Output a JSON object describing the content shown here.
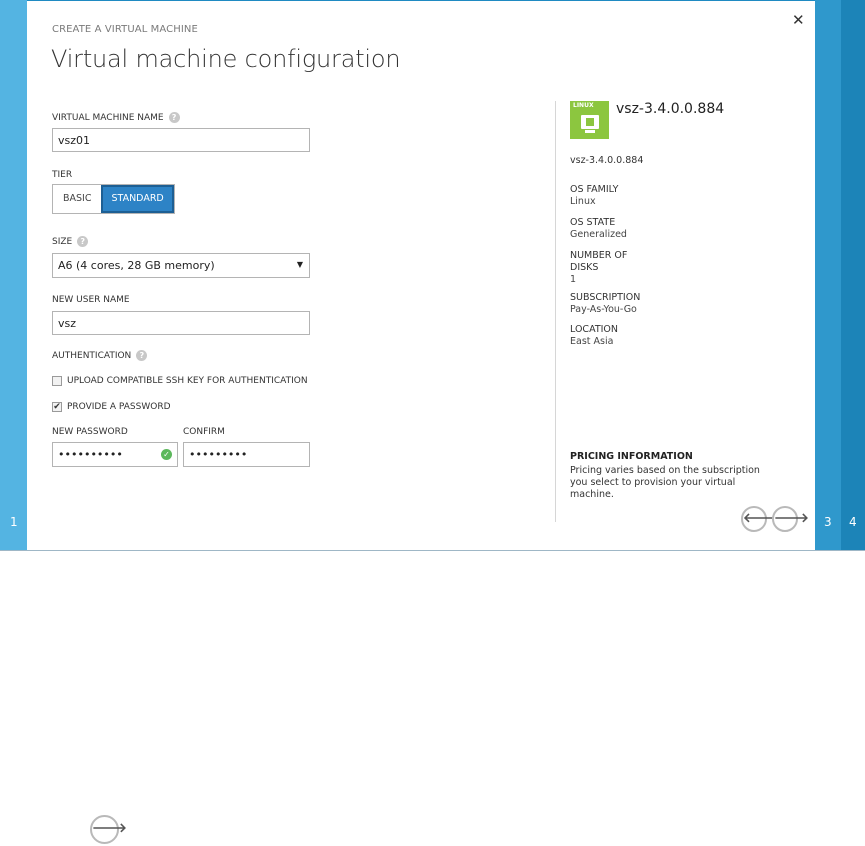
{
  "steps": {
    "step1": "1",
    "step3": "3",
    "step4": "4"
  },
  "header": {
    "caption": "CREATE A VIRTUAL MACHINE",
    "title": "Virtual machine configuration",
    "close_icon": "close-icon"
  },
  "form": {
    "vm_name_label": "VIRTUAL MACHINE NAME",
    "vm_name_value": "vsz01",
    "tier_label": "TIER",
    "tier_options": [
      "BASIC",
      "STANDARD"
    ],
    "tier_selected": "STANDARD",
    "size_label": "SIZE",
    "size_value": "A6 (4 cores, 28 GB memory)",
    "user_label": "NEW USER NAME",
    "user_value": "vsz",
    "auth_label": "AUTHENTICATION",
    "ssh_label": "UPLOAD COMPATIBLE SSH KEY FOR AUTHENTICATION",
    "ssh_checked": false,
    "password_option_label": "PROVIDE A PASSWORD",
    "password_option_checked": true,
    "new_password_label": "NEW PASSWORD",
    "new_password_value": "••••••••••",
    "confirm_label": "CONFIRM",
    "confirm_value": "•••••••••"
  },
  "image_info": {
    "tile_tag": "LINUX",
    "heading": "vsz-3.4.0.0.884",
    "name": "vsz-3.4.0.0.884",
    "os_family_label": "OS FAMILY",
    "os_family_value": "Linux",
    "os_state_label": "OS STATE",
    "os_state_value": "Generalized",
    "disks_label_1": "NUMBER OF",
    "disks_label_2": "DISKS",
    "disks_value": "1",
    "subscription_label": "SUBSCRIPTION",
    "subscription_value": "Pay-As-You-Go",
    "location_label": "LOCATION",
    "location_value": "East Asia",
    "pricing_heading": "PRICING INFORMATION",
    "pricing_text": "Pricing varies based on the subscription you select to provision your virtual machine."
  },
  "nav": {
    "back_glyph": "🡐",
    "next_glyph": "🡒",
    "lower_next_glyph": "🡒"
  },
  "colors": {
    "accent": "#2d83c6",
    "rail_light": "#54b4e2",
    "rail_mid": "#2f98cc",
    "rail_dark": "#1c84b8",
    "tile_green": "#8cc63f",
    "valid_green": "#5cb85c"
  }
}
